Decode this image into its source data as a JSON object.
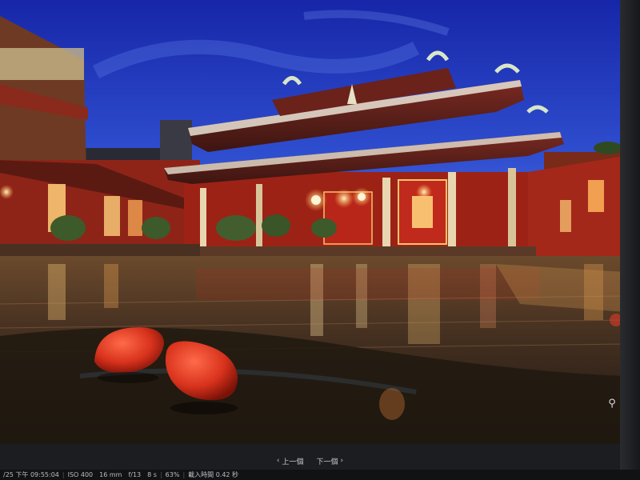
{
  "viewer": {
    "prev_label": "上一個",
    "next_label": "下一個",
    "prev_icon": "chevron-left-icon",
    "next_icon": "chevron-right-icon",
    "zoom_icon": "magnifier-icon",
    "zoom_glyph": "⚲"
  },
  "status": {
    "datetime": "/25 下午 09:55:04",
    "iso": "ISO 400",
    "focal_length": "16 mm",
    "aperture": "f/13",
    "shutter": "8 s",
    "zoom": "63%",
    "load_time": "載入時間 0.42 秒"
  },
  "colors": {
    "sky_top": "#1a2bb8",
    "sky_bottom": "#3c5bd6",
    "temple_red": "#b3231a",
    "lantern_glow": "#ffd27a",
    "ground": "#3b2a1e"
  }
}
